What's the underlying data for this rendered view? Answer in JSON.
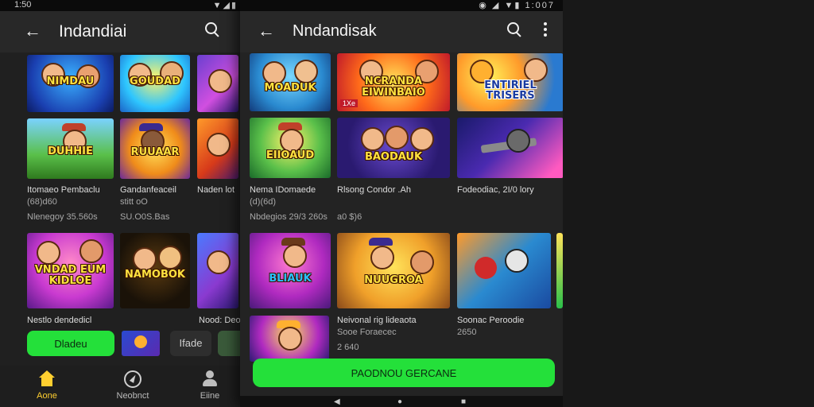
{
  "left": {
    "status": {
      "time": "1:50",
      "icons": "▼◢▮"
    },
    "title": "Indandiai",
    "games": [
      {
        "title": "NIMDAU"
      },
      {
        "title": "GOUDAD"
      },
      {
        "title": ""
      },
      {
        "title": "DUHHIE"
      },
      {
        "title": "RUUAAR"
      },
      {
        "title": ""
      },
      {
        "title": "VNDAD EUM KIDLOE"
      },
      {
        "title": "NAMOBOK"
      },
      {
        "title": ""
      }
    ],
    "captions": [
      {
        "line1": "Itomaeo Pembaclu",
        "line2": "(68)d60",
        "line3": "Nlenegoy 35.560s"
      },
      {
        "line1": "Gandanfeaceil",
        "line2": "stitt oO",
        "line3": "SU.O0S.Bas"
      },
      {
        "line1": "Naden lot",
        "line2": "",
        "line3": ""
      },
      {
        "line1": "Nestlo dendedicl",
        "line2": "",
        "line3": ""
      },
      {
        "line1": "Nood: Deo",
        "line2": "",
        "line3": ""
      }
    ],
    "buttons": {
      "primary": "Dladeu",
      "secondary": "Ifade"
    },
    "nav": [
      {
        "label": "Aone",
        "icon": "home-icon"
      },
      {
        "label": "Neobnct",
        "icon": "discover-icon"
      },
      {
        "label": "Eiine",
        "icon": "people-icon"
      }
    ]
  },
  "right": {
    "status": {
      "icons": "◉ ◢ ▼▮",
      "time": "1:007"
    },
    "title": "Nndandisak",
    "games": [
      {
        "title": "MOADUK"
      },
      {
        "title": "NCRANDA EIWINBAIO"
      },
      {
        "title": "ENTIRIEL TRISERS"
      },
      {
        "title": "EIIOAUD"
      },
      {
        "title": "BAODAUK"
      },
      {
        "title": ""
      },
      {
        "title": "BLIAUK"
      },
      {
        "title": "NUUGROA"
      },
      {
        "title": ""
      },
      {
        "title": ""
      }
    ],
    "captions": [
      {
        "line1": "Nema IDomaede",
        "line2": "(d)(6d)",
        "line3": "Nbdegios 29/3 260s"
      },
      {
        "line1": "Rlsong Condor .Ah",
        "line2": "",
        "line3": "a0 $)6"
      },
      {
        "line1": "Fodeodiac, 2I/0 lory",
        "line2": "",
        "line3": ""
      },
      {
        "line1": "Neivonal rig lideaota",
        "line2": "Sooe Foraecec",
        "line3": "2 640"
      },
      {
        "line1": "Soonac Peroodie",
        "line2": "2650",
        "line3": ""
      }
    ],
    "tile_badge": "1Xe",
    "primary_button": "PAODNOU GERCANE"
  },
  "colors": {
    "accent_green": "#24e03a",
    "nav_active": "#ffcf30"
  }
}
